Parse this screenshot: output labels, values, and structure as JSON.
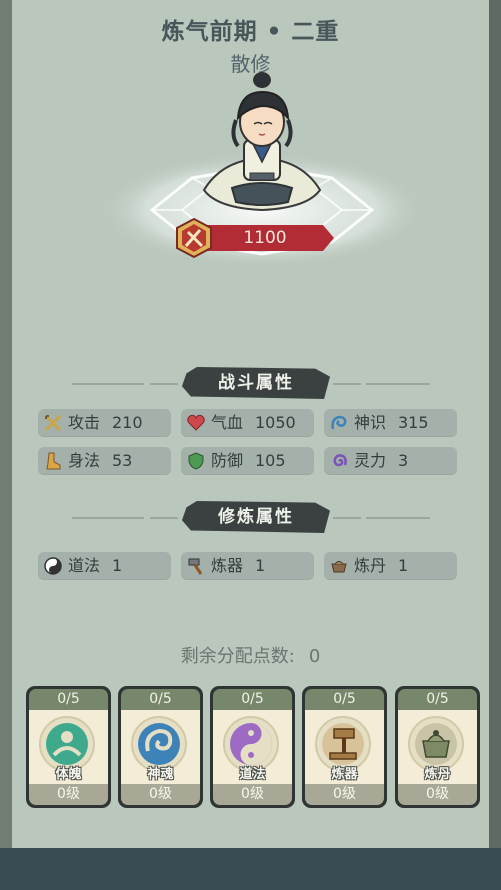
{
  "header": {
    "realm": "炼气前期 • 二重",
    "sect": "散修"
  },
  "power": {
    "value": "1100"
  },
  "combat": {
    "title": "战斗属性",
    "stats": [
      {
        "icon": "crossed-swords-icon",
        "label": "攻击",
        "value": "210"
      },
      {
        "icon": "heart-icon",
        "label": "气血",
        "value": "1050"
      },
      {
        "icon": "swirl-icon",
        "label": "神识",
        "value": "315"
      },
      {
        "icon": "boot-icon",
        "label": "身法",
        "value": "53"
      },
      {
        "icon": "shield-icon",
        "label": "防御",
        "value": "105"
      },
      {
        "icon": "spiral-icon",
        "label": "灵力",
        "value": "3"
      }
    ]
  },
  "cultivation": {
    "title": "修炼属性",
    "stats": [
      {
        "icon": "yin-yang-icon",
        "label": "道法",
        "value": "1"
      },
      {
        "icon": "hammer-icon",
        "label": "炼器",
        "value": "1"
      },
      {
        "icon": "cauldron-icon",
        "label": "炼丹",
        "value": "1"
      }
    ]
  },
  "points": {
    "label": "剩余分配点数:",
    "value": "0"
  },
  "cards": [
    {
      "name": "体魄",
      "progress": "0/5",
      "level": "0级",
      "icon": "body-emblem-icon",
      "color": "#3fa98c"
    },
    {
      "name": "神魂",
      "progress": "0/5",
      "level": "0级",
      "icon": "soul-emblem-icon",
      "color": "#3e83b8"
    },
    {
      "name": "道法",
      "progress": "0/5",
      "level": "0级",
      "icon": "dao-emblem-icon",
      "color": "#9d6ac4"
    },
    {
      "name": "炼器",
      "progress": "0/5",
      "level": "0级",
      "icon": "forge-emblem-icon",
      "color": "#c79a56"
    },
    {
      "name": "炼丹",
      "progress": "0/5",
      "level": "0级",
      "icon": "alchemy-emblem-icon",
      "color": "#7d8a64"
    }
  ]
}
